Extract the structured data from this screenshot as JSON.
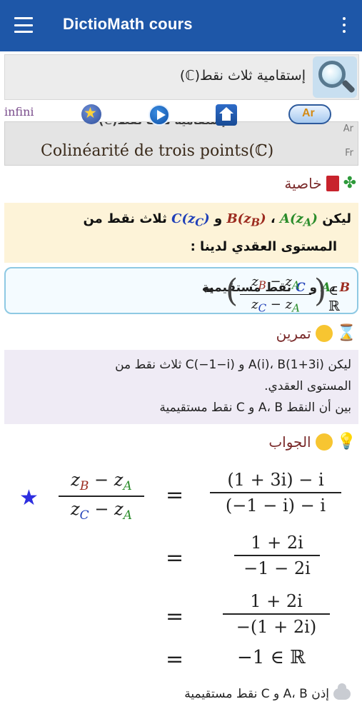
{
  "app": {
    "title": "DictioMath cours",
    "menu_icon": "hamburger-menu-icon",
    "more_icon": "overflow-vertical-icon"
  },
  "search": {
    "value": "إستقامية ثلاث نقط(ℂ)",
    "icon": "magnifier-icon"
  },
  "toolbar": {
    "infini_label": "infini",
    "lang_toggle_label": "Ar",
    "icons": [
      "favorites-star-icon",
      "play-icon",
      "home-icon",
      "language-toggle-icon"
    ]
  },
  "title_card": {
    "ar_title": "إستقامية ثلاث نقط(ℂ)",
    "fr_title": "Colinéarité de trois points(ℂ)",
    "lang_ar": "Ar",
    "lang_fr": "Fr"
  },
  "property": {
    "heading": "خاصية",
    "line1_prefix": "ليكن",
    "A": "A(z",
    "B": "B(z",
    "C": "C(z",
    "sub_A": "A",
    "sub_B": "B",
    "sub_C": "C",
    "and": "و",
    "comma": "،",
    "line1_suffix": "ثلاث نقط من",
    "line2": "المستوى العقدي لدينا :",
    "equiv_text": "نقط مستقيمية",
    "equiv_in": "∈ ℝ",
    "equiv_arrow": "⇔"
  },
  "exercise": {
    "heading": "تمرين",
    "line1": "ليكن  A(i)، B(1+3i) و C(−1−i) ثلاث نقط من",
    "line2": "المستوى العقدي.",
    "line3": "بين أن النقط A، B و C نقط مستقيمية"
  },
  "solution": {
    "heading": "الجواب",
    "rhs1_num": "(1 + 3i) − i",
    "rhs1_den": "(−1 − i) − i",
    "rhs2_num": "1 + 2i",
    "rhs2_den": "−1 − 2i",
    "rhs3_num": "1 + 2i",
    "rhs3_den": "−(1 + 2i)",
    "rhs4": "−1 ∈ ℝ",
    "equals": "=",
    "conclusion": "إذن A، B و C نقط مستقيمية"
  },
  "colors": {
    "appbar": "#1e57a8",
    "prop_bg": "#fdf3d8",
    "exo_bg": "#efebf5",
    "heading": "#7a2a2a",
    "point_a": "#2a8c2a",
    "point_b": "#9c2b1f",
    "point_c": "#1f3fb8"
  }
}
